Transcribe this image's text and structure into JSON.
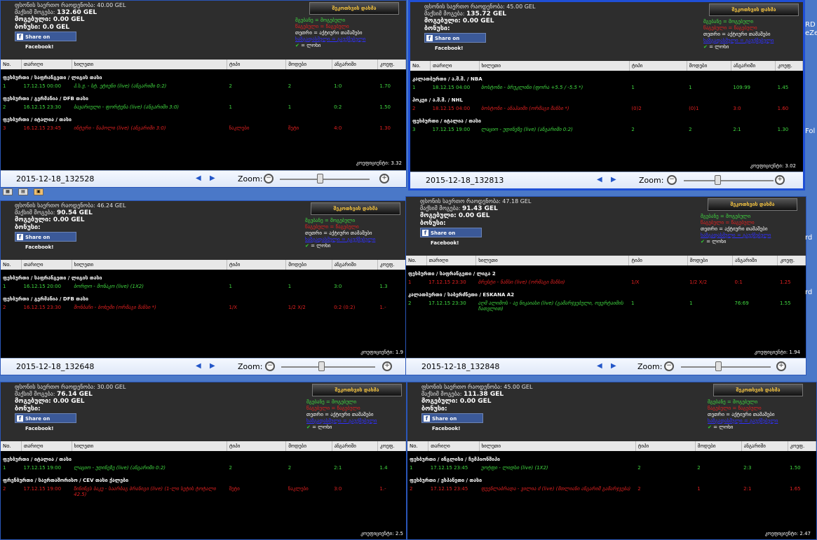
{
  "labels": {
    "fb": "Share on Facebook!",
    "fb_f": "f",
    "ticket_btn": "შეკოთხვის დახმა",
    "legend_won": "მგებანე = მოგებული",
    "legend_lost": "წაგებული = წაგებული",
    "legend_pending": "თეთრი = აქტიური თამაშები",
    "legend_cancel": "ხაზგადასმული = გაუქმებული",
    "legend_check_mark": "✔",
    "legend_check": " = ლოხი",
    "col_no": "No.",
    "col_date": "თარიღი",
    "col_event": "ხილეთი",
    "col_type": "ტიპი",
    "col_choice": "მოდები",
    "col_result": "ანგარიში",
    "col_coef": "კოეფ.",
    "zoom": "Zoom:",
    "nav_prev": "◀",
    "nav_next": "▶",
    "zoom_out": "−",
    "zoom_in": "+",
    "coef_prefix": "კოეფიციენტი: "
  },
  "panes": [
    {
      "filename": "2015-12-18_132528",
      "stake": "ფსონის საერთო რაოდენობა: 40.00 GEL",
      "max_win_label": "მაქსიმ მოგება:",
      "max_win": "132.60 GEL",
      "won": "მოგებული: 0.00 GEL",
      "bonus": "ბონუსი: 0.0 GEL",
      "total_coef": "3.32",
      "groups": [
        {
          "category": "ფეხბურთი / საფრანგეთი / ლიგის თასი",
          "rows": [
            {
              "no": "1",
              "status": "won",
              "date": "17.12.15 00:00",
              "event": "პ.ს.ჟ. - სტ. ეტიენი (live) (ანგარიში 0:2)",
              "type": "2",
              "choice": "2",
              "result": "1:0",
              "coef": "1.70"
            }
          ]
        },
        {
          "category": "ფეხბურთი / გერმანია / DFB თასი",
          "rows": [
            {
              "no": "2",
              "status": "won",
              "date": "16.12.15 23:30",
              "event": "ბავარიული - ფორტუნა (live) (ანგარიში 3:0)",
              "type": "1",
              "choice": "1",
              "result": "0:2",
              "coef": "1.50"
            }
          ]
        },
        {
          "category": "ფეხბურთი / იტალია / თასი",
          "rows": [
            {
              "no": "3",
              "status": "lost",
              "date": "16.12.15 23:45",
              "event": "ინტერი - ნაპოლი (live) (ანგარიში 3:0)",
              "type": "ნაკლები",
              "choice": "მეტი",
              "result": "4:0",
              "coef": "1.30"
            }
          ]
        }
      ]
    },
    {
      "filename": "2015-12-18_132813",
      "stake": "ფსონის საერთო რაოდენობა: 45.00 GEL",
      "max_win_label": "მაქსიმ მოგება:",
      "max_win": "135.72 GEL",
      "won": "მოგებული: 0.00 GEL",
      "bonus": "ბონუსი:",
      "total_coef": "3.02",
      "groups": [
        {
          "category": "კალათბურთი / ა.შ.შ. / NBA",
          "rows": [
            {
              "no": "1",
              "status": "won",
              "date": "18.12.15 04:00",
              "event": "ბოსტონი - ბრუკლინი (ფორა +5.5 / -5.5 *)",
              "type": "1",
              "choice": "1",
              "result": "109:99",
              "coef": "1.45"
            }
          ]
        },
        {
          "category": "ჰოკეი / ა.შ.შ. / NHL",
          "rows": [
            {
              "no": "2",
              "status": "lost",
              "date": "18.12.15 04:00",
              "event": "ბოსტონი - ანაჰაიმი (ორმაგი შანსი *)",
              "type": "(0)2",
              "choice": "(0)1",
              "result": "3:0",
              "coef": "1.60"
            }
          ]
        },
        {
          "category": "ფეხბურთი / იტალია / თასი",
          "rows": [
            {
              "no": "3",
              "status": "won",
              "date": "17.12.15 19:00",
              "event": "ლაციო - უდინეზე (live) (ანგარიში 0:2)",
              "type": "2",
              "choice": "2",
              "result": "2:1",
              "coef": "1.30"
            }
          ]
        }
      ]
    },
    {
      "filename": "2015-12-18_132648",
      "stake": "ფსონის საერთო რაოდენობა: 46.24 GEL",
      "max_win_label": "მაქსიმ მოგება:",
      "max_win": "90.54 GEL",
      "won": "მოგებული: 0.00 GEL",
      "bonus": "ბონუსი:",
      "total_coef": "1.9",
      "groups": [
        {
          "category": "ფეხბურთი / საფრანგეთი / ლიგის თასი",
          "rows": [
            {
              "no": "1",
              "status": "won",
              "date": "16.12.15 20:00",
              "event": "ბორდო - მონაკო (live) (1X2)",
              "type": "1",
              "choice": "1",
              "result": "3:0",
              "coef": "1.3"
            }
          ]
        },
        {
          "category": "ფეხბურთი / გერმანია / DFB თასი",
          "rows": [
            {
              "no": "2",
              "status": "lost",
              "date": "16.12.15 23:30",
              "event": "შონბაჩი - ბოხუმი (ორმაგი შანსი *)",
              "type": "1/X",
              "choice": "1/2 X/2",
              "result": "0:2 (0:2)",
              "coef": "1.-"
            }
          ]
        }
      ]
    },
    {
      "filename": "2015-12-18_132848",
      "stake": "ფსონის საერთო რაოდენობა: 47.18 GEL",
      "max_win_label": "მაქსიმ მოგება:",
      "max_win": "91.43 GEL",
      "won": "მოგებული: 0.00 GEL",
      "bonus": "ბონუსი:",
      "total_coef": "1.94",
      "groups": [
        {
          "category": "ფეხბურთი / საფრანგეთი / ლიგა 2",
          "rows": [
            {
              "no": "1",
              "status": "lost",
              "date": "17.12.15 23:30",
              "event": "ბრესტი - ნანსი (live) (ორმაგი შანსი)",
              "type": "1/X",
              "choice": "1/2 X/2",
              "result": "0:1",
              "coef": "1.25"
            }
          ]
        },
        {
          "category": "კალათბურთი / საბერძნეთი / ESKANA A2",
          "rows": [
            {
              "no": "2",
              "status": "won",
              "date": "17.12.15 23:30",
              "event": "აღმ ალიმოს - აე ნიკაიასი (live) (გამარჯვებული, ოვერტაიმის ჩათვლით)",
              "type": "1",
              "choice": "1",
              "result": "76:69",
              "coef": "1.55"
            }
          ]
        }
      ]
    },
    {
      "filename": "",
      "stake": "ფსონის საერთო რაოდენობა: 30.00 GEL",
      "max_win_label": "მაქსიმ მოგება:",
      "max_win": "76.14 GEL",
      "won": "მოგებული: 0.00 GEL",
      "bonus": "ბონუსი:",
      "total_coef": "2.5",
      "groups": [
        {
          "category": "ფეხბურთი / იტალია / თასი",
          "rows": [
            {
              "no": "1",
              "status": "won",
              "date": "17.12.15 19:00",
              "event": "ლაციო - უდინეზე (live) (ანგარიში 0:2)",
              "type": "2",
              "choice": "2",
              "result": "2:1",
              "coef": "1.4"
            }
          ]
        },
        {
          "category": "ფრენბურთი / საერთაშორისო / CEV თასი ქალები",
          "rows": [
            {
              "no": "2",
              "status": "lost",
              "date": "17.12.15 19:00",
              "event": "ზინინგს ბაკუ - საარბაგ ბრანიგი (live) (1-ლი სეტის ტოტალი 42.5)",
              "type": "მეტი",
              "choice": "ნაკლები",
              "result": "3:0",
              "coef": "1.-"
            }
          ]
        }
      ]
    },
    {
      "filename": "",
      "stake": "ფსონის საერთო რაოდენობა: 45.00 GEL",
      "max_win_label": "მაქსიმ მოგება:",
      "max_win": "111.38 GEL",
      "won": "მოგებული: 0.00 GEL",
      "bonus": "ბონუსი:",
      "total_coef": "2.47",
      "groups": [
        {
          "category": "ფეხბურთი / ინგლისი / ჩემპიონშიპი",
          "rows": [
            {
              "no": "1",
              "status": "won",
              "date": "17.12.15 23:45",
              "event": "უოტფი - ლიდსი (live) (1X2)",
              "type": "2",
              "choice": "2",
              "result": "2:3",
              "coef": "1.50"
            }
          ]
        },
        {
          "category": "ფეხბურთი / ესპანეთი / თასი",
          "rows": [
            {
              "no": "2",
              "status": "lost",
              "date": "17.12.15 23:45",
              "event": "ფუენლაბრადა - ვილია ძ (live) (მთლიანი ანგარიშ გამარჯვება)",
              "type": "2",
              "choice": "1",
              "result": "2:1",
              "coef": "1.65"
            }
          ]
        }
      ]
    }
  ],
  "side_texts": [
    "RD",
    "eZe",
    "Fol",
    "rd",
    "rd"
  ]
}
